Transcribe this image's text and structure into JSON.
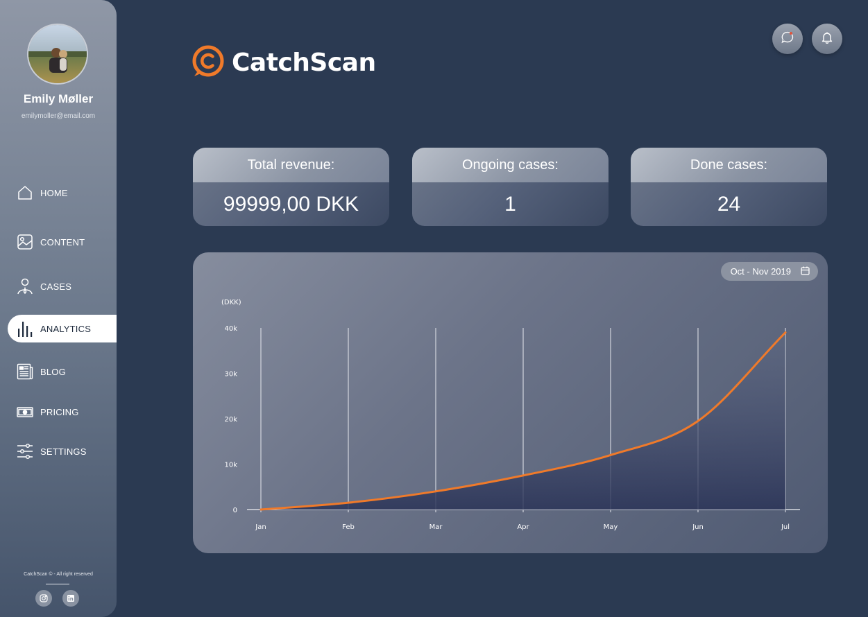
{
  "user": {
    "name": "Emily Møller",
    "email": "emilymoller@email.com"
  },
  "nav": {
    "items": [
      {
        "label": "HOME",
        "icon": "home-icon"
      },
      {
        "label": "CONTENT",
        "icon": "image-icon"
      },
      {
        "label": "CASES",
        "icon": "person-icon"
      },
      {
        "label": "ANALYTICS",
        "icon": "bar-chart-icon",
        "active": true
      },
      {
        "label": "BLOG",
        "icon": "newspaper-icon"
      },
      {
        "label": "PRICING",
        "icon": "banknote-icon"
      },
      {
        "label": "SETTINGS",
        "icon": "sliders-icon"
      }
    ]
  },
  "footer": {
    "copyright": "CatchScan © - All right reserved",
    "social": [
      "instagram-icon",
      "linkedin-icon"
    ]
  },
  "header": {
    "logo_text": "CatchScan",
    "accent_color": "#f07a2a"
  },
  "stats": [
    {
      "label": "Total revenue:",
      "value": "99999,00 DKK"
    },
    {
      "label": "Ongoing cases:",
      "value": "1"
    },
    {
      "label": "Done cases:",
      "value": "24"
    }
  ],
  "chart_filter": {
    "date_range": "Oct - Nov 2019"
  },
  "chart_data": {
    "type": "area",
    "ylabel": "(DKK)",
    "categories": [
      "Jan",
      "Feb",
      "Mar",
      "Apr",
      "May",
      "Jun",
      "Jul"
    ],
    "y_ticks": [
      "0",
      "10k",
      "20k",
      "30k",
      "40k"
    ],
    "ylim": [
      0,
      40000
    ],
    "series": [
      {
        "values": [
          0,
          1500,
          4000,
          7500,
          12000,
          19500,
          39000
        ],
        "color": "#f07a2a"
      }
    ],
    "grid": "vertical"
  }
}
